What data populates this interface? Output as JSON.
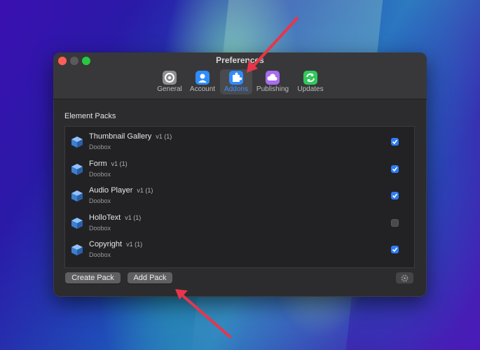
{
  "window": {
    "title": "Preferences"
  },
  "toolbar": {
    "tabs": [
      {
        "label": "General",
        "icon": "gear-icon",
        "color": "#8e8e93"
      },
      {
        "label": "Account",
        "icon": "person-icon",
        "color": "#2f8cff"
      },
      {
        "label": "Addons",
        "icon": "puzzle-icon",
        "color": "#2f8cff",
        "selected": true
      },
      {
        "label": "Publishing",
        "icon": "cloud-icon",
        "color": "#a76cf0"
      },
      {
        "label": "Updates",
        "icon": "refresh-icon",
        "color": "#30c85a"
      }
    ]
  },
  "element_packs": {
    "heading": "Element Packs",
    "items": [
      {
        "name": "Thumbnail Gallery",
        "version": "v1 (1)",
        "vendor": "Doobox",
        "enabled": true
      },
      {
        "name": "Form",
        "version": "v1 (1)",
        "vendor": "Doobox",
        "enabled": true
      },
      {
        "name": "Audio Player",
        "version": "v1 (1)",
        "vendor": "Doobox",
        "enabled": true
      },
      {
        "name": "HolloText",
        "version": "v1 (1)",
        "vendor": "Doobox",
        "enabled": false
      },
      {
        "name": "Copyright",
        "version": "v1 (1)",
        "vendor": "Doobox",
        "enabled": true
      }
    ]
  },
  "buttons": {
    "create_pack": "Create Pack",
    "add_pack": "Add Pack",
    "settings_icon": "gear-icon"
  },
  "colors": {
    "accent": "#2f7cf6",
    "annotation_arrow": "#e8354a"
  }
}
